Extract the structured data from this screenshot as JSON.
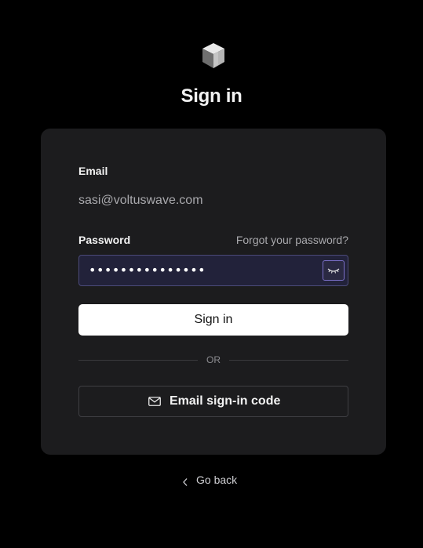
{
  "header": {
    "logo_icon": "cube-logo-icon",
    "title": "Sign in"
  },
  "form": {
    "email_label": "Email",
    "email_value": "sasi@voltuswave.com",
    "password_label": "Password",
    "forgot_password_link": "Forgot your password?",
    "password_masked": "•••••••••••••••",
    "toggle_icon": "eye-closed-icon",
    "signin_button": "Sign in",
    "divider_text": "OR",
    "email_code_button": "Email sign-in code",
    "email_code_icon": "mail-icon"
  },
  "footer": {
    "go_back": "Go back",
    "go_back_icon": "chevron-left-icon"
  },
  "colors": {
    "background": "#000000",
    "card": "#1c1c1e",
    "password_field_bg": "#22223a",
    "accent_border": "#7b70c8",
    "primary_button": "#ffffff"
  }
}
